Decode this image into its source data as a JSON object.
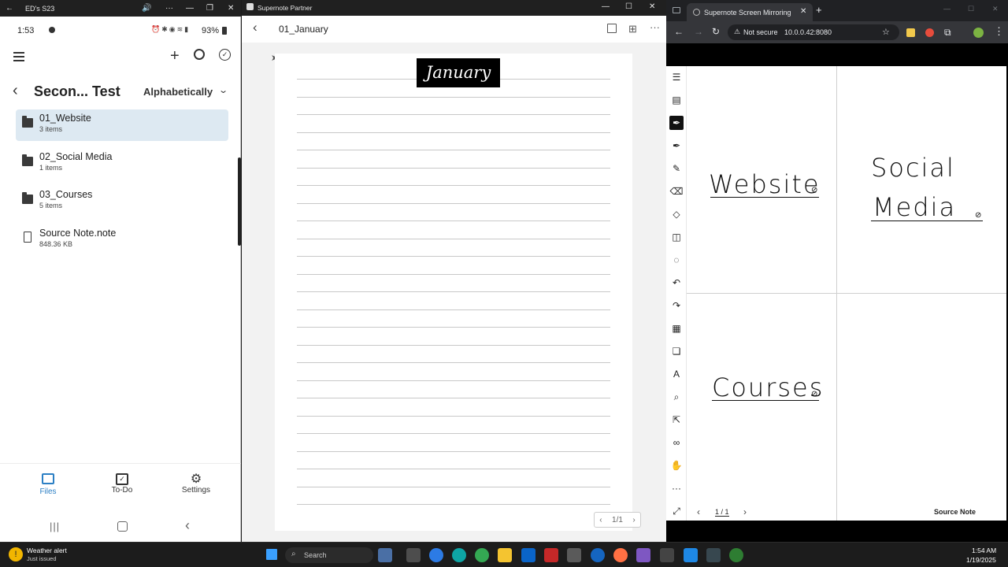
{
  "phone_window": {
    "title": "ED's S23",
    "status": {
      "time": "1:53",
      "battery": "93%"
    },
    "breadcrumb": {
      "folder": "Secon... Test",
      "sort": "Alphabetically"
    },
    "files": [
      {
        "name": "01_Website",
        "sub": "3 items"
      },
      {
        "name": "02_Social Media",
        "sub": "1 items"
      },
      {
        "name": "03_Courses",
        "sub": "5 items"
      },
      {
        "name": "Source Note.note",
        "sub": "848.36 KB"
      }
    ],
    "bottom_nav": {
      "files": "Files",
      "todo": "To-Do",
      "settings": "Settings"
    },
    "accent": "#2b7fc4"
  },
  "partner_window": {
    "title": "Supernote Partner",
    "header_title": "01_January",
    "page_title": "January",
    "pager": "1/1"
  },
  "browser_window": {
    "tab_title": "Supernote Screen Mirroring",
    "url_warning": "Not secure",
    "url": "10.0.0.42:8080",
    "mirror": {
      "labels": {
        "website": "Website",
        "social1": "Social",
        "social2": "Media",
        "courses": "Courses"
      },
      "page_indicator": "1 / 1",
      "note_name": "Source Note"
    }
  },
  "taskbar": {
    "weather_title": "Weather alert",
    "weather_sub": "Just issued",
    "search": "Search",
    "time": "1:54 AM",
    "date": "1/19/2025"
  }
}
